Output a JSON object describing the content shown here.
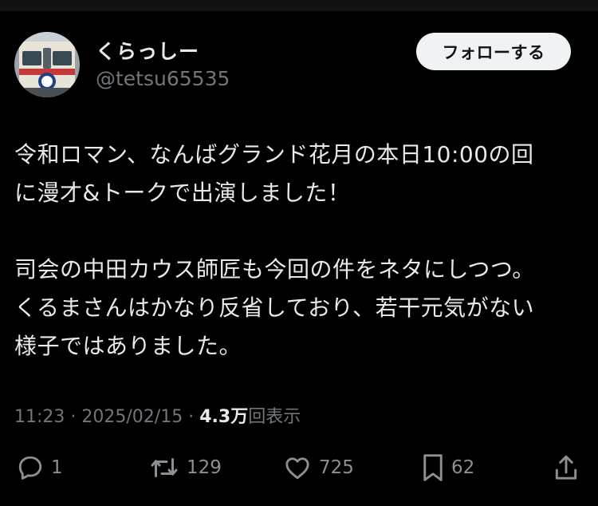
{
  "author": {
    "display_name": "くらっしー",
    "handle": "@tetsu65535",
    "avatar_icon": "train-avatar-icon"
  },
  "follow_button": {
    "label": "フォローする"
  },
  "tweet": {
    "paragraphs": [
      [
        "令和ロマン、なんばグランド花月の本日10:00の回",
        "に漫才&トークで出演しました！"
      ],
      [
        "司会の中田カウス師匠も今回の件をネタにしつつ。",
        "くるまさんはかなり反省しており、若干元気がない",
        "様子ではありました。"
      ]
    ]
  },
  "meta": {
    "time": "11:23",
    "separator": "·",
    "date": "2025/02/15",
    "views_count": "4.3万",
    "views_label": "回表示"
  },
  "actions": {
    "reply": {
      "icon": "reply-icon",
      "count": "1"
    },
    "retweet": {
      "icon": "retweet-icon",
      "count": "129"
    },
    "like": {
      "icon": "heart-icon",
      "count": "725"
    },
    "bookmark": {
      "icon": "bookmark-icon",
      "count": "62"
    },
    "share": {
      "icon": "share-icon"
    }
  },
  "colors": {
    "background": "#000000",
    "text_primary": "#e7e9ea",
    "text_secondary": "#71767b",
    "follow_button_bg": "#eff3f4"
  }
}
